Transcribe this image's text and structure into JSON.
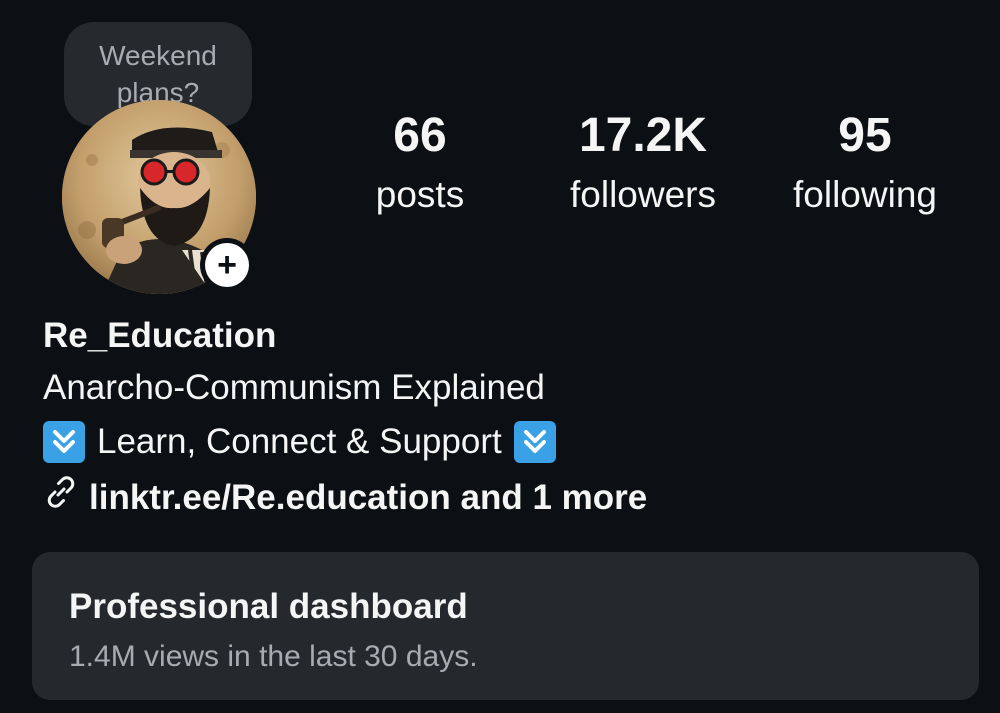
{
  "note": {
    "text": "Weekend plans?"
  },
  "profile": {
    "avatar_alt": "profile-avatar",
    "add_icon": "plus-icon"
  },
  "stats": {
    "posts": {
      "value": "66",
      "label": "posts"
    },
    "followers": {
      "value": "17.2K",
      "label": "followers"
    },
    "following": {
      "value": "95",
      "label": "following"
    }
  },
  "bio": {
    "username": "Re_Education",
    "line1": "Anarcho-Communism Explained",
    "line2": "Learn, Connect & Support",
    "line2_icon": "double-down-arrow-emoji-icon",
    "link": "linktr.ee/Re.education and 1 more",
    "link_icon": "link-icon"
  },
  "dashboard": {
    "title": "Professional dashboard",
    "subtitle": "1.4M views in the last 30 days."
  },
  "colors": {
    "background": "#0c1014",
    "card": "#25292e",
    "muted_text": "#a8acb1",
    "emoji_blue": "#3aa1e6"
  }
}
